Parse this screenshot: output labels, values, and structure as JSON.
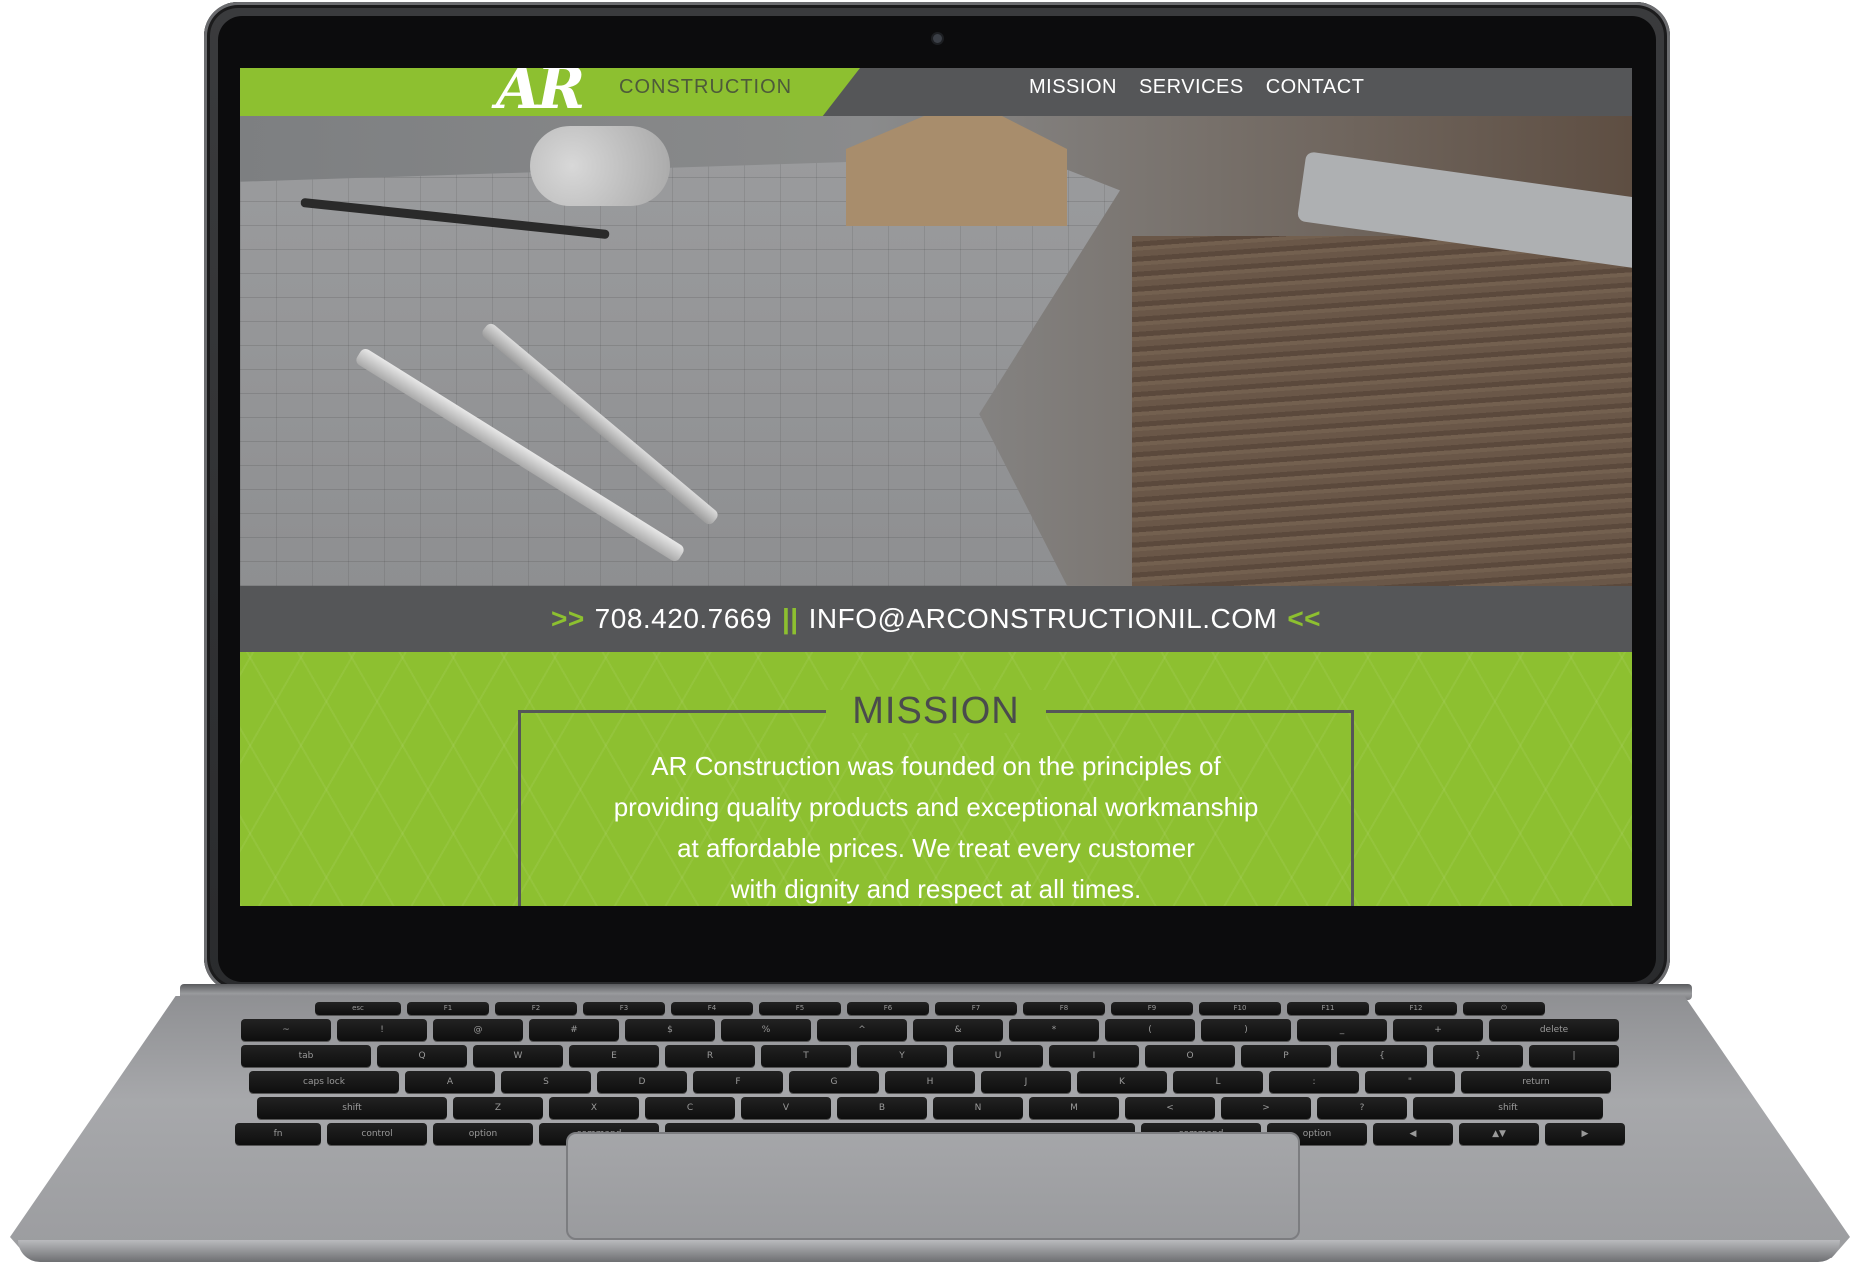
{
  "site": {
    "logo_mark": "AR",
    "logo_text": "CONSTRUCTION",
    "nav": [
      "MISSION",
      "SERVICES",
      "CONTACT"
    ]
  },
  "contact_bar": {
    "left_arrows": ">>",
    "phone": "708.420.7669",
    "separator": "||",
    "email": "INFO@ARCONSTRUCTIONIL.COM",
    "right_arrows": "<<"
  },
  "mission": {
    "title": "MISSION",
    "lines": [
      "AR Construction was founded on the principles of",
      "providing quality products and exceptional workmanship",
      "at affordable prices. We treat every customer",
      "with dignity and respect at all times."
    ]
  },
  "keyboard": {
    "row_fn": [
      "esc",
      "F1",
      "F2",
      "F3",
      "F4",
      "F5",
      "F6",
      "F7",
      "F8",
      "F9",
      "F10",
      "F11",
      "F12",
      "⏻"
    ],
    "row1": [
      "~",
      "!",
      "@",
      "#",
      "$",
      "%",
      "^",
      "&",
      "*",
      "(",
      ")",
      "_",
      "+",
      "delete"
    ],
    "row2": [
      "tab",
      "Q",
      "W",
      "E",
      "R",
      "T",
      "Y",
      "U",
      "I",
      "O",
      "P",
      "{",
      "}",
      "|"
    ],
    "row3": [
      "caps lock",
      "A",
      "S",
      "D",
      "F",
      "G",
      "H",
      "J",
      "K",
      "L",
      ":",
      "\"",
      "return"
    ],
    "row4": [
      "shift",
      "Z",
      "X",
      "C",
      "V",
      "B",
      "N",
      "M",
      "<",
      ">",
      "?",
      "shift"
    ],
    "row5": [
      "fn",
      "control",
      "option",
      "command",
      "",
      "command",
      "option",
      "◀",
      "▲▼",
      "▶"
    ]
  },
  "colors": {
    "brand_green": "#8dc030",
    "dark_gray": "#555658"
  }
}
